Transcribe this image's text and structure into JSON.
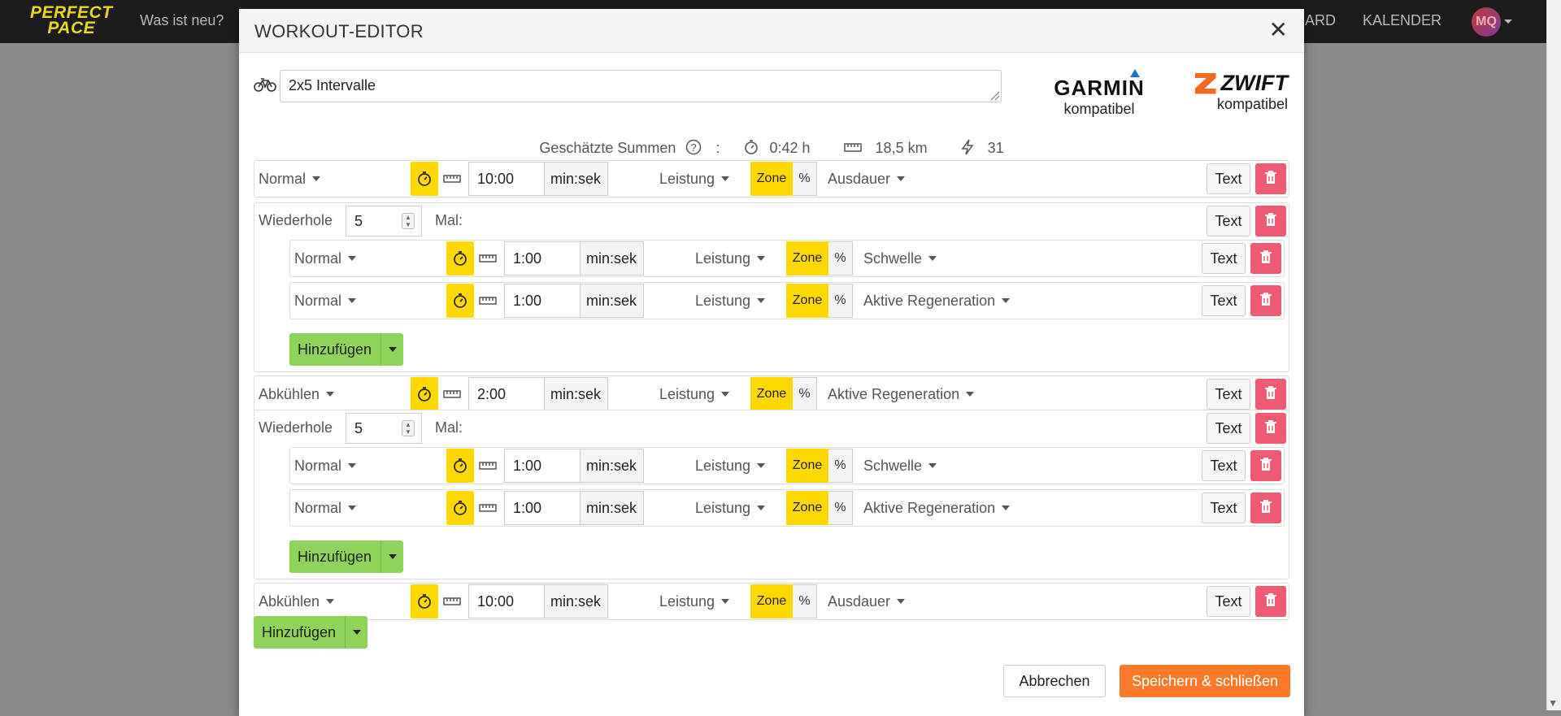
{
  "navbar": {
    "logo_line1": "PERFECT",
    "logo_line2": "PACE",
    "links": [
      "Was ist neu?",
      "ARD",
      "KALENDER"
    ],
    "avatar_initials": "MQ"
  },
  "modal": {
    "title": "WORKOUT-EDITOR",
    "workout_name": "2x5 Intervalle",
    "garmin": {
      "logo": "GARMIN",
      "label": "kompatibel"
    },
    "zwift": {
      "logo": "ZWIFT",
      "label": "kompatibel"
    },
    "summary": {
      "label": "Geschätzte Summen",
      "suffix": " :",
      "duration": "0:42 h",
      "distance": "18,5 km",
      "load": "31"
    },
    "labels": {
      "unit": "min:sek",
      "metric": "Leistung",
      "zone": "Zone",
      "percent": "%",
      "text": "Text",
      "repeat": "Wiederhole",
      "times": "Mal:",
      "add": "Hinzufügen"
    },
    "steps": [
      {
        "type": "Normal",
        "duration": "10:00",
        "target": "Ausdauer"
      },
      {
        "repeat": "5",
        "children": [
          {
            "type": "Normal",
            "duration": "1:00",
            "target": "Schwelle"
          },
          {
            "type": "Normal",
            "duration": "1:00",
            "target": "Aktive Regeneration"
          }
        ]
      },
      {
        "type": "Abkühlen",
        "duration": "2:00",
        "target": "Aktive Regeneration"
      },
      {
        "repeat": "5",
        "children": [
          {
            "type": "Normal",
            "duration": "1:00",
            "target": "Schwelle"
          },
          {
            "type": "Normal",
            "duration": "1:00",
            "target": "Aktive Regeneration"
          }
        ]
      },
      {
        "type": "Abkühlen",
        "duration": "10:00",
        "target": "Ausdauer"
      }
    ],
    "buttons": {
      "cancel": "Abbrechen",
      "save": "Speichern & schließen"
    }
  },
  "colors": {
    "yellow": "#ffd900",
    "delete": "#ef5b75",
    "add": "#8ed35a",
    "save": "#fb7a28",
    "navbar": "#1c1c1c"
  }
}
